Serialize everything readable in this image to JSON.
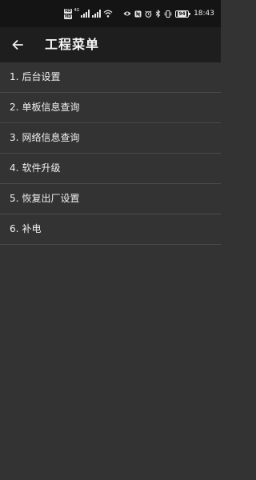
{
  "status_bar": {
    "sim_tags": [
      "HD",
      "HD"
    ],
    "net_type": "4G",
    "battery": "94",
    "time": "18:43"
  },
  "app_bar": {
    "title": "工程菜单"
  },
  "menu": {
    "items": [
      {
        "num": "1.",
        "label": "后台设置"
      },
      {
        "num": "2.",
        "label": "单板信息查询"
      },
      {
        "num": "3.",
        "label": "网络信息查询"
      },
      {
        "num": "4.",
        "label": "软件升级"
      },
      {
        "num": "5.",
        "label": "恢复出厂设置"
      },
      {
        "num": "6.",
        "label": "补电"
      }
    ]
  },
  "colors": {
    "background": "#333333",
    "status_bar": "#141414",
    "app_bar": "#1e1e1e",
    "divider": "#4a4a4a",
    "text": "#f0f0f0"
  },
  "icons": [
    "back-arrow-icon",
    "signal-icon",
    "wifi-icon",
    "eye-icon",
    "nfc-icon",
    "alarm-icon",
    "bluetooth-icon",
    "vibrate-icon",
    "battery-icon"
  ]
}
